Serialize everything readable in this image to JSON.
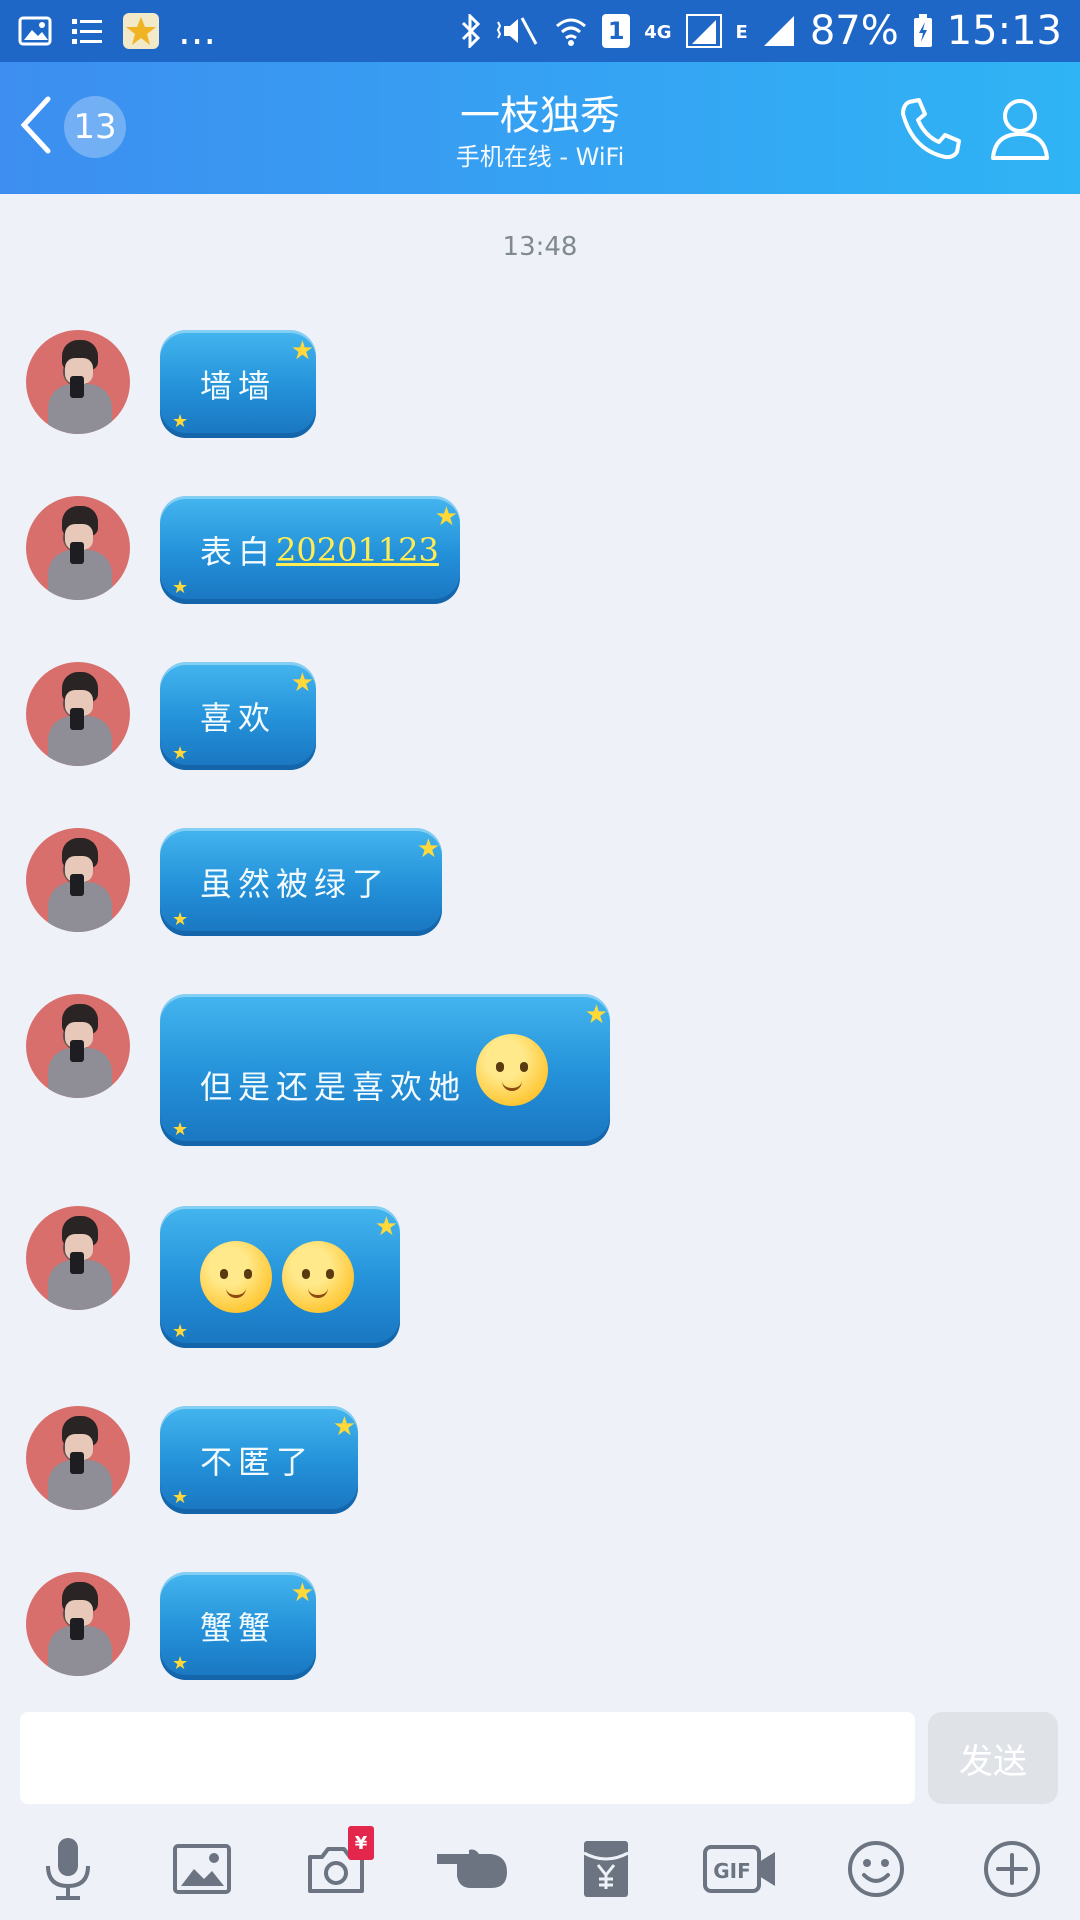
{
  "status_bar": {
    "battery": "87%",
    "time": "15:13",
    "network_4g": "4G",
    "network_e": "E",
    "sim_slot": "1",
    "more": "..."
  },
  "header": {
    "unread_count": "13",
    "title": "一枝独秀",
    "subtitle": "手机在线 - WiFi"
  },
  "chat": {
    "timestamp": "13:48",
    "messages": [
      {
        "text": "墙墙"
      },
      {
        "text": "表白",
        "link": "20201123"
      },
      {
        "text": "喜欢"
      },
      {
        "text": "虽然被绿了"
      },
      {
        "text": "但是还是喜欢她"
      },
      {
        "text": ""
      },
      {
        "text": "不匿了"
      },
      {
        "text": "蟹蟹"
      }
    ]
  },
  "input": {
    "value": "",
    "send_label": "发送"
  },
  "toolbar": {
    "redpacket_symbol": "¥",
    "gif_label": "GIF",
    "items": [
      "microphone-icon",
      "image-icon",
      "camera-icon",
      "poke-icon",
      "red-packet-icon",
      "gif-icon",
      "emoji-icon",
      "plus-icon"
    ]
  },
  "colors": {
    "header_start": "#3d8ef0",
    "header_end": "#2fb4f5",
    "bubble": "#2390d8",
    "background": "#eef2f8"
  }
}
